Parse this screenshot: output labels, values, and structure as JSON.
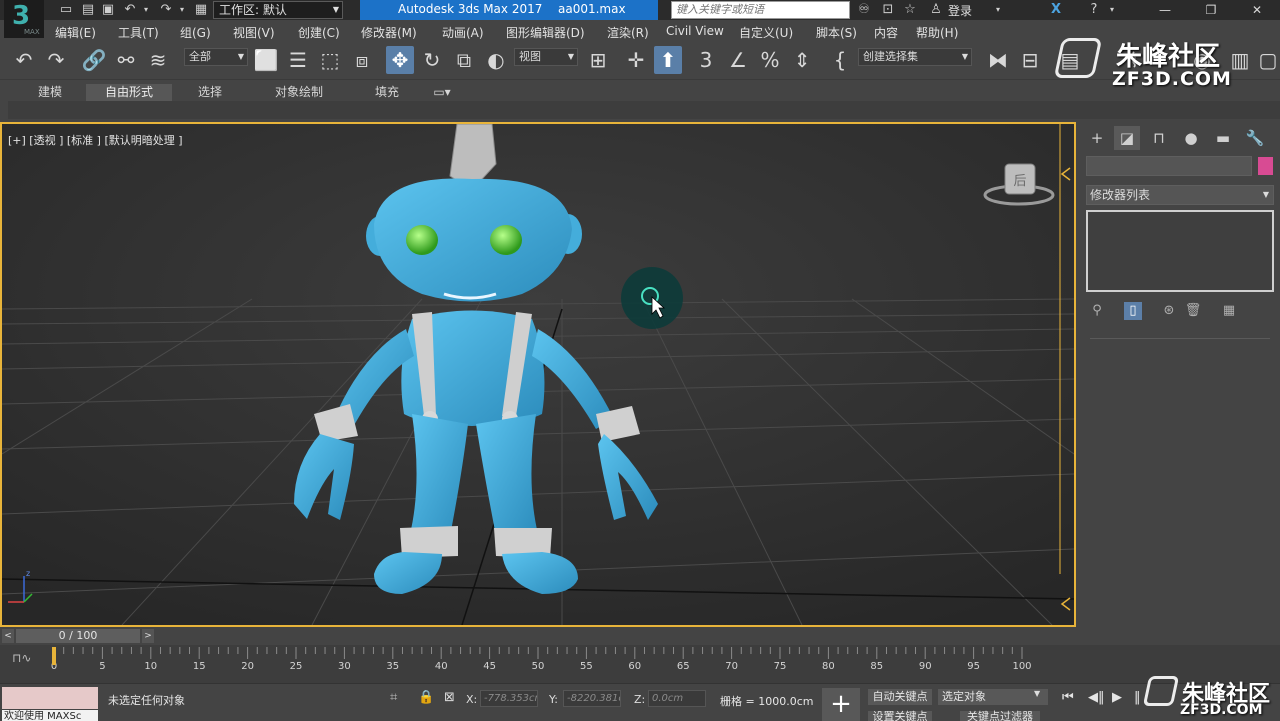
{
  "title_bar": {
    "logo_text": "3",
    "logo_sub": "MAX",
    "workspace_label": "工作区: 默认",
    "app_title": "Autodesk 3ds Max 2017",
    "file_name": "aa001.max",
    "search_placeholder": "键入关键字或短语",
    "login_label": "登录"
  },
  "menu": [
    "编辑(E)",
    "工具(T)",
    "组(G)",
    "视图(V)",
    "创建(C)",
    "修改器(M)",
    "动画(A)",
    "图形编辑器(D)",
    "渲染(R)",
    "Civil View",
    "自定义(U)",
    "脚本(S)",
    "内容",
    "帮助(H)"
  ],
  "toolbar": {
    "filter_value": "全部",
    "coord_system_value": "视图",
    "selection_set_placeholder": "创建选择集"
  },
  "ribbon_tabs": [
    "建模",
    "自由形式",
    "选择",
    "对象绘制",
    "填充"
  ],
  "viewport": {
    "label": "[+] [透视 ] [标准 ] [默认明暗处理 ]",
    "viewcube_face": "后"
  },
  "command_panel": {
    "modifier_list_label": "修改器列表",
    "object_color": "#d84b93"
  },
  "timeline": {
    "frame_display": "0 / 100",
    "ticks": [
      "0",
      "5",
      "10",
      "15",
      "20",
      "25",
      "30",
      "35",
      "40",
      "45",
      "50",
      "55",
      "60",
      "65",
      "70",
      "75",
      "80",
      "85",
      "90",
      "95",
      "100"
    ]
  },
  "status": {
    "maxscript_text": "欢迎使用 MAXSc",
    "status_text": "未选定任何对象",
    "x_label": "X:",
    "x_value": "-778.353cm",
    "y_label": "Y:",
    "y_value": "-8220.381c",
    "z_label": "Z:",
    "z_value": "0.0cm",
    "grid_text": "栅格 = 1000.0cm",
    "auto_key": "自动关键点",
    "selected_object": "选定对象",
    "set_key": "设置关键点",
    "key_filters": "关键点过滤器"
  },
  "watermark": {
    "brand_cn": "朱峰社区",
    "brand_en": "ZF3D.COM"
  },
  "colors": {
    "accent": "#1c72c8",
    "viewport_border": "#e8b43a",
    "character": "#3aa6d6"
  }
}
